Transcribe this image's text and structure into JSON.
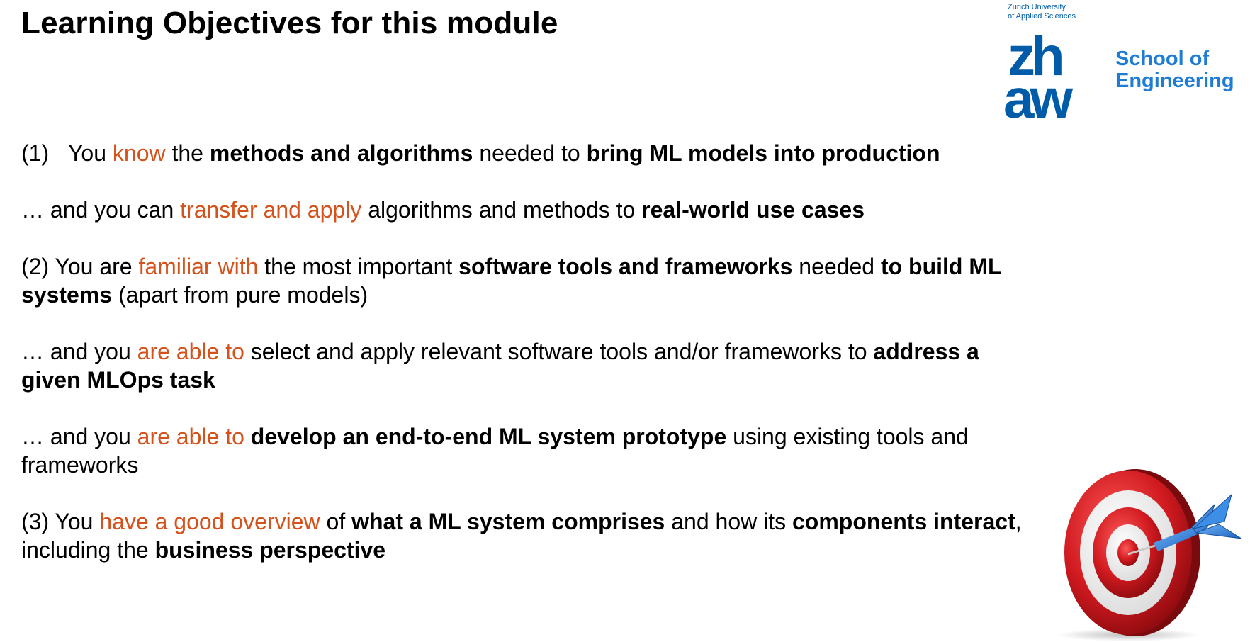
{
  "slide": {
    "title": "Learning Objectives for this module"
  },
  "logo": {
    "university_line1": "Zurich University",
    "university_line2": "of Applied Sciences",
    "mark_line1": "zh",
    "mark_line2": "aw",
    "school_line1": "School of",
    "school_line2": "Engineering",
    "brand_color": "#005ca9",
    "school_color": "#1f7cd3"
  },
  "objectives": [
    {
      "prefix": "(1)",
      "segments": [
        {
          "t": "You "
        },
        {
          "t": "know",
          "style": "verb"
        },
        {
          "t": " the "
        },
        {
          "t": "methods and algorithms",
          "style": "bold"
        },
        {
          "t": " needed to "
        },
        {
          "t": "bring ML models into production",
          "style": "bold"
        }
      ]
    },
    {
      "segments": [
        {
          "t": "… and you can "
        },
        {
          "t": "transfer and apply",
          "style": "verb"
        },
        {
          "t": " algorithms and methods to "
        },
        {
          "t": "real-world use cases",
          "style": "bold"
        }
      ]
    },
    {
      "segments": [
        {
          "t": "(2) You are "
        },
        {
          "t": "familiar with",
          "style": "verb"
        },
        {
          "t": " the most important "
        },
        {
          "t": "software tools and frameworks",
          "style": "bold"
        },
        {
          "t": " needed "
        },
        {
          "t": "to build ML systems",
          "style": "bold"
        },
        {
          "t": " (apart from pure models)"
        }
      ]
    },
    {
      "segments": [
        {
          "t": "… and you "
        },
        {
          "t": "are able to",
          "style": "verb"
        },
        {
          "t": " select and apply relevant software tools and/or frameworks to "
        },
        {
          "t": "address a given MLOps task",
          "style": "bold"
        }
      ]
    },
    {
      "segments": [
        {
          "t": "… and you "
        },
        {
          "t": "are able to",
          "style": "verb"
        },
        {
          "t": " "
        },
        {
          "t": "develop an end-to-end ML system prototype",
          "style": "bold"
        },
        {
          "t": " using existing tools and frameworks"
        }
      ]
    },
    {
      "segments": [
        {
          "t": "(3) You "
        },
        {
          "t": "have a good overview",
          "style": "verb"
        },
        {
          "t": " of "
        },
        {
          "t": "what a ML system comprises",
          "style": "bold"
        },
        {
          "t": " and how its "
        },
        {
          "t": "components interact",
          "style": "bold"
        },
        {
          "t": ", including the "
        },
        {
          "t": "business perspective",
          "style": "bold"
        }
      ]
    }
  ],
  "colors": {
    "text": "#000000",
    "verb_highlight": "#d4531c",
    "target_red": "#c8141c",
    "dart_blue": "#2f7fd6"
  },
  "icons": {
    "logo": "zhaw-logo",
    "illustration": "dartboard-target-icon"
  }
}
